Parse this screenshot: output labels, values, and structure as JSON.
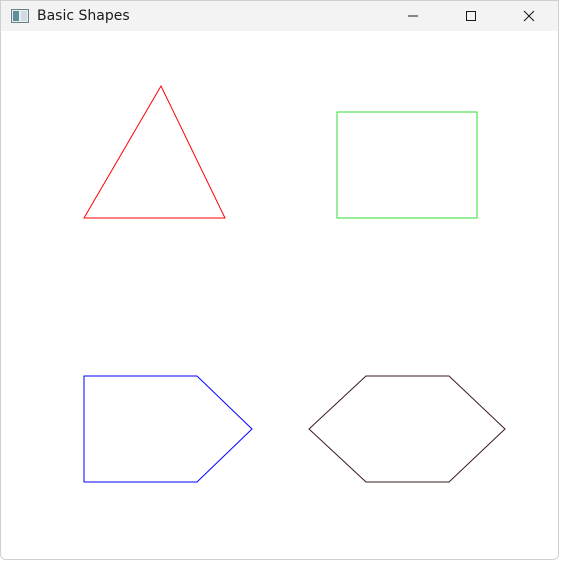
{
  "window": {
    "title": "Basic Shapes",
    "icon": "window-app-icon",
    "controls": [
      "minimize-icon",
      "maximize-icon",
      "close-icon"
    ]
  },
  "shapes": [
    {
      "name": "triangle",
      "stroke": "#ff0000"
    },
    {
      "name": "rectangle",
      "stroke": "#33dd33"
    },
    {
      "name": "pentagon",
      "stroke": "#0000ff"
    },
    {
      "name": "hexagon",
      "stroke": "#3a1a1a"
    }
  ]
}
